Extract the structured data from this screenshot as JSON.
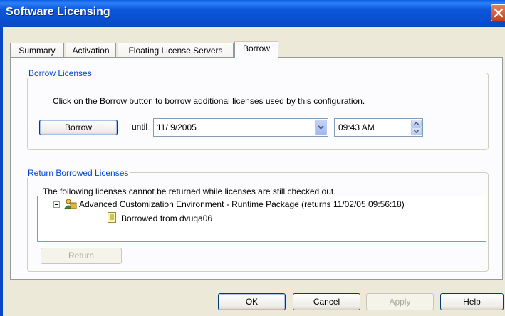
{
  "window": {
    "title": "Software Licensing"
  },
  "tabs": [
    {
      "label": "Summary",
      "active": false
    },
    {
      "label": "Activation",
      "active": false
    },
    {
      "label": "Floating License Servers",
      "active": false
    },
    {
      "label": "Borrow",
      "active": true
    }
  ],
  "borrow": {
    "group_label": "Borrow Licenses",
    "instruction": "Click on the Borrow button to borrow additional licenses used by this configuration.",
    "button_label": "Borrow",
    "until_label": "until",
    "date_value": "11/ 9/2005",
    "time_value": "09:43 AM"
  },
  "return": {
    "group_label": "Return Borrowed Licenses",
    "note": "The following licenses cannot be returned while licenses are still checked out.",
    "tree": {
      "parent_label": "Advanced Customization Environment - Runtime Package (returns 11/02/05 09:56:18)",
      "child_label": "Borrowed from dvuqa06"
    },
    "button_label": "Return"
  },
  "footer": {
    "ok_label": "OK",
    "cancel_label": "Cancel",
    "apply_label": "Apply",
    "help_label": "Help"
  },
  "colors": {
    "title_bar": "#0a5fe0",
    "group_label": "#0046d5",
    "dialog_bg": "#ece9d8"
  },
  "icons": [
    "close-icon",
    "dropdown-arrow-icon",
    "spin-up-icon",
    "spin-down-icon",
    "collapse-icon",
    "license-package-icon",
    "document-icon"
  ]
}
